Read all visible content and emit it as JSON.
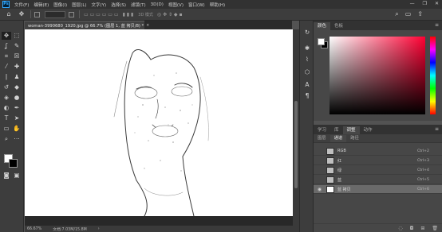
{
  "app": {
    "logo_text": "Ps"
  },
  "menu": {
    "items": [
      "文件(F)",
      "编辑(E)",
      "图像(I)",
      "图层(L)",
      "文字(Y)",
      "选择(S)",
      "滤镜(T)",
      "3D(D)",
      "视图(V)",
      "窗口(W)",
      "帮助(H)"
    ],
    "window_controls": [
      "—",
      "❐",
      "✕"
    ]
  },
  "options_bar": {
    "mode_label": "3D 模式"
  },
  "document": {
    "tab_title": "woman-3990680_1920.jpg @ 66.7% (图层 1, 蓝 拷贝/8) *",
    "close_glyph": "×"
  },
  "status": {
    "zoom": "66.67%",
    "doc_size": "文档:7.03M/15.8M",
    "arrow": "›"
  },
  "panels": {
    "color": {
      "tabs": [
        "颜色",
        "色板"
      ]
    },
    "channels_group": {
      "tabs": [
        "学习",
        "库",
        "调整",
        "动作"
      ],
      "subtabs": [
        "图层",
        "通道",
        "路径"
      ],
      "channels": [
        {
          "name": "RGB",
          "shortcut": "Ctrl+2"
        },
        {
          "name": "红",
          "shortcut": "Ctrl+3"
        },
        {
          "name": "绿",
          "shortcut": "Ctrl+4"
        },
        {
          "name": "蓝",
          "shortcut": "Ctrl+5"
        },
        {
          "name": "蓝 拷贝",
          "shortcut": "Ctrl+6"
        }
      ]
    }
  },
  "colors": {
    "foreground": "#ffffff",
    "background": "#000000",
    "picker_hue": "#ff0033",
    "selected_row": "#6a6a6a"
  }
}
